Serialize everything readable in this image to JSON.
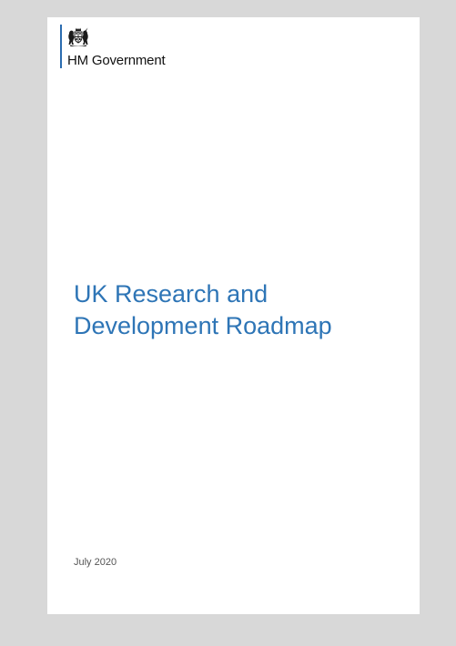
{
  "header": {
    "organisation": "HM Government",
    "crest_icon": "royal-coat-of-arms-icon"
  },
  "cover": {
    "title_line_1": "UK Research and",
    "title_line_2": "Development Roadmap",
    "date": "July 2020"
  },
  "colors": {
    "title": "#2e75b6",
    "logo_rule": "#2b6cb0",
    "viewer_background": "#d8d8d8",
    "page_background": "#ffffff"
  }
}
